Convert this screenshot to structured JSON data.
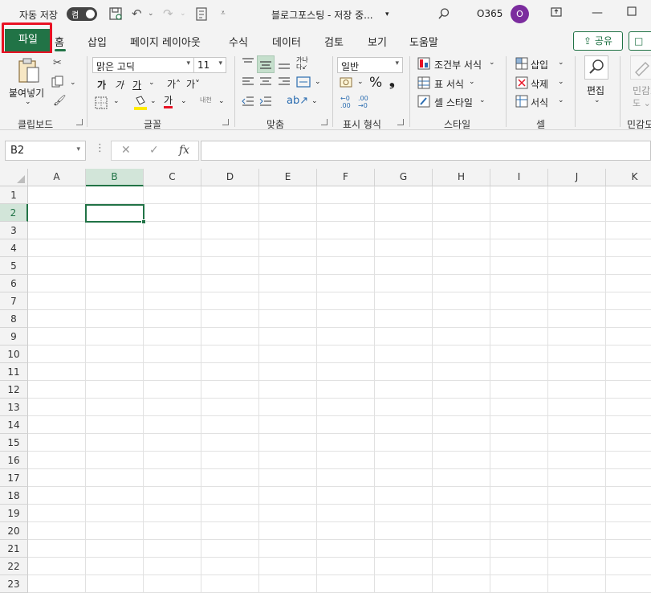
{
  "titlebar": {
    "autosave_label": "자동 저장",
    "autosave_state": "켬",
    "document_title": "블로그포스팅 - 저장 중...",
    "account_name": "O365",
    "avatar_initial": "O"
  },
  "tabs": [
    "파일",
    "홈",
    "삽입",
    "페이지 레이아웃",
    "수식",
    "데이터",
    "검토",
    "보기",
    "도움말"
  ],
  "share_label": "공유",
  "comment_label": "□",
  "ribbon": {
    "clipboard": {
      "paste_label": "붙여넣기",
      "group_label": "클립보드"
    },
    "font": {
      "font_name": "맑은 고딕",
      "font_size": "11",
      "bold": "가",
      "italic": "가",
      "underline": "가",
      "grow": "가˄",
      "shrink": "가˅",
      "color_glyph": "가",
      "phonetic": "내천",
      "group_label": "글꼴"
    },
    "alignment": {
      "group_label": "맞춤"
    },
    "number": {
      "format": "일반",
      "percent": "%",
      "comma": "❟",
      "group_label": "표시 형식"
    },
    "styles": {
      "conditional": "조건부 서식",
      "table": "표 서식",
      "cell_style": "셀 스타일",
      "group_label": "스타일"
    },
    "cells": {
      "insert": "삽입",
      "delete": "삭제",
      "format": "서식",
      "group_label": "셀"
    },
    "editing": {
      "label": "편집"
    },
    "sensitivity": {
      "label": "민감도",
      "group_label": "민감도"
    }
  },
  "formula_bar": {
    "name_box": "B2",
    "fx": "fx",
    "formula": ""
  },
  "grid": {
    "columns": [
      "A",
      "B",
      "C",
      "D",
      "E",
      "F",
      "G",
      "H",
      "I",
      "J",
      "K"
    ],
    "rows": [
      "1",
      "2",
      "3",
      "4",
      "5",
      "6",
      "7",
      "8",
      "9",
      "10",
      "11",
      "12",
      "13",
      "14",
      "15",
      "16",
      "17",
      "18",
      "19",
      "20",
      "21",
      "22",
      "23"
    ],
    "selected_column": "B",
    "selected_row": "2"
  },
  "colors": {
    "accent": "#217346",
    "highlight_box": "#e81123",
    "avatar": "#7b2c9e"
  }
}
